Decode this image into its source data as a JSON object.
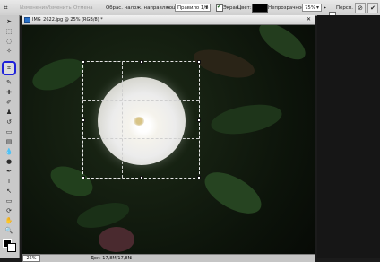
{
  "options_bar": {
    "ghost_buttons": [
      "Изменения",
      "Изменить",
      "Отмена"
    ],
    "mode_label": "Обрас. налож. направляюш.:",
    "mode_value": "Правило 1/3",
    "shield_label": "Экран",
    "color_label": "Цвет:",
    "opacity_label": "Непрозрачность:",
    "opacity_value": "75%",
    "perspective_label": "Персп.",
    "shield_checked": true,
    "perspective_checked": false,
    "shield_color": "#000000"
  },
  "document": {
    "title": "IMG_2622.jpg @ 25% (RGB/8) *",
    "zoom": "25%",
    "doc_size": "Док: 17,8M/17,8M"
  },
  "colors": {
    "crop_tool_highlight": "#1f22d9"
  }
}
